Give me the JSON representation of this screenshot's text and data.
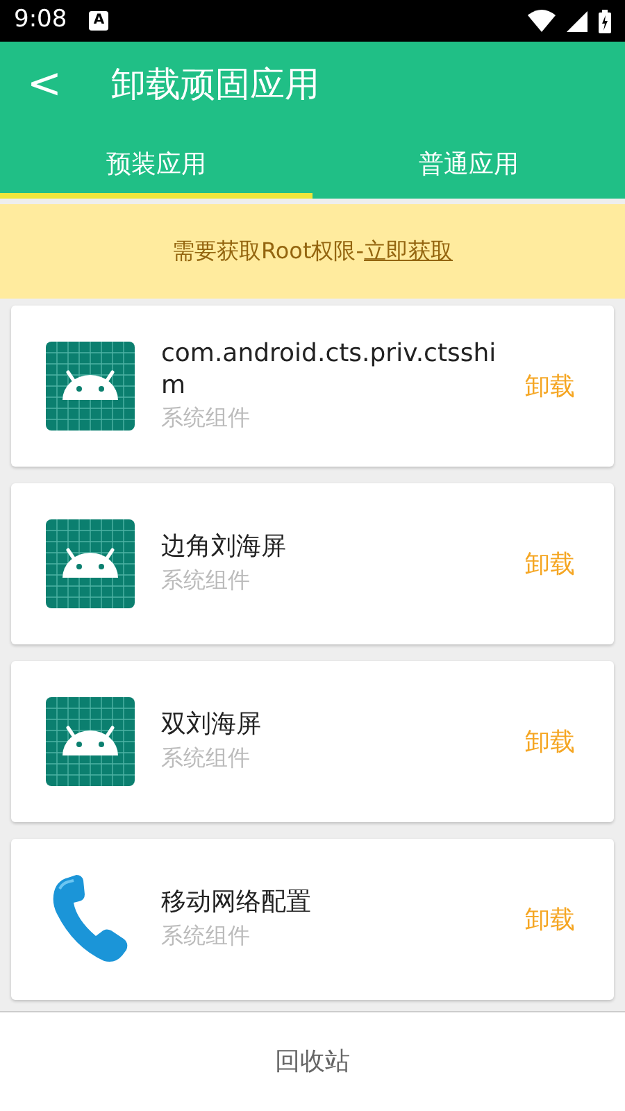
{
  "status_bar": {
    "time": "9:08",
    "notification": "A"
  },
  "toolbar": {
    "back": "<",
    "title": "卸载顽固应用"
  },
  "tabs": [
    {
      "label": "预装应用",
      "selected": true
    },
    {
      "label": "普通应用",
      "selected": false
    }
  ],
  "banner": {
    "text": "需要获取Root权限-",
    "link": "立即获取"
  },
  "apps": [
    {
      "kind": "android",
      "name": "com.android.cts.priv.ctsshim",
      "subtitle": "系统组件",
      "action": "卸载"
    },
    {
      "kind": "android",
      "name": "边角刘海屏",
      "subtitle": "系统组件",
      "action": "卸载"
    },
    {
      "kind": "android",
      "name": "双刘海屏",
      "subtitle": "系统组件",
      "action": "卸载"
    },
    {
      "kind": "phone",
      "name": "移动网络配置",
      "subtitle": "系统组件",
      "action": "卸载"
    }
  ],
  "bottom_button": "回收站"
}
